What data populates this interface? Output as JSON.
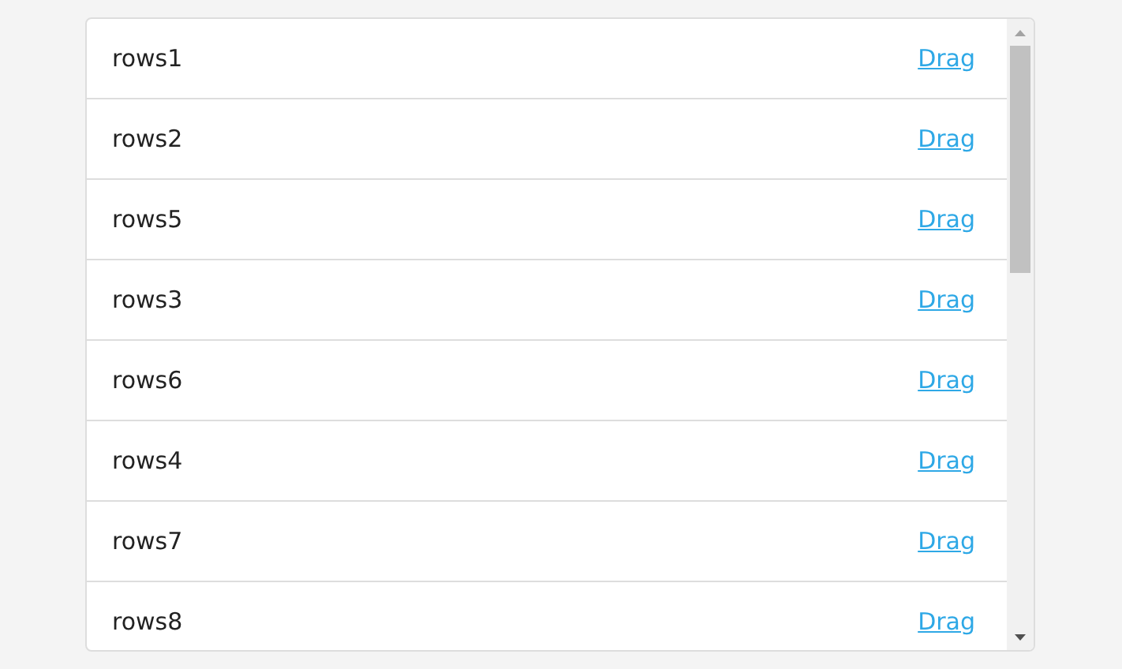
{
  "rows": [
    {
      "label": "rows1",
      "action": "Drag"
    },
    {
      "label": "rows2",
      "action": "Drag"
    },
    {
      "label": "rows5",
      "action": "Drag"
    },
    {
      "label": "rows3",
      "action": "Drag"
    },
    {
      "label": "rows6",
      "action": "Drag"
    },
    {
      "label": "rows4",
      "action": "Drag"
    },
    {
      "label": "rows7",
      "action": "Drag"
    },
    {
      "label": "rows8",
      "action": "Drag"
    }
  ]
}
